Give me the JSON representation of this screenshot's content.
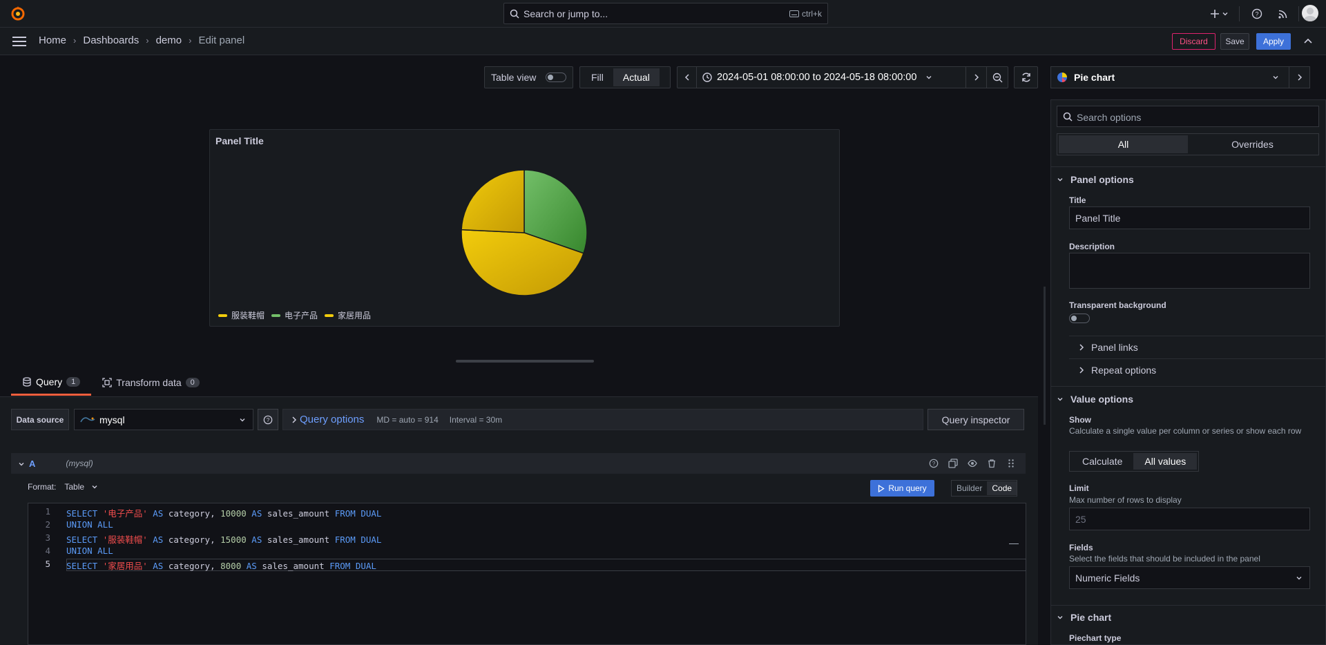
{
  "topbar": {
    "search_placeholder": "Search or jump to...",
    "search_shortcut": "ctrl+k"
  },
  "breadcrumb": {
    "items": [
      "Home",
      "Dashboards",
      "demo"
    ],
    "current": "Edit panel"
  },
  "actions": {
    "discard": "Discard",
    "save": "Save",
    "apply": "Apply"
  },
  "viz_toolbar": {
    "table_view": "Table view",
    "fill": "Fill",
    "actual": "Actual",
    "time_range": "2024-05-01 08:00:00 to 2024-05-18 08:00:00"
  },
  "panel": {
    "title": "Panel Title",
    "legend": [
      {
        "label": "服装鞋帽",
        "color": "#f2cc0c"
      },
      {
        "label": "电子产品",
        "color": "#73bf69"
      },
      {
        "label": "家居用品",
        "color": "#f2cc0c"
      }
    ]
  },
  "chart_data": {
    "type": "pie",
    "categories": [
      "电子产品",
      "服装鞋帽",
      "家居用品"
    ],
    "values": [
      10000,
      15000,
      8000
    ],
    "colors": [
      "#73bf69",
      "#f2cc0c",
      "#f2cc0c"
    ],
    "legend_position": "bottom-left"
  },
  "query_tabs": [
    {
      "label": "Query",
      "count": "1"
    },
    {
      "label": "Transform data",
      "count": "0"
    }
  ],
  "query": {
    "data_source_label": "Data source",
    "data_source": "mysql",
    "options_label": "Query options",
    "md_info": "MD = auto = 914",
    "interval_info": "Interval = 30m",
    "inspector": "Query inspector",
    "ref_id": "A",
    "ref_ds": "(mysql)",
    "format_label": "Format:",
    "format_value": "Table",
    "run": "Run query",
    "builder": "Builder",
    "code": "Code",
    "lines": [
      {
        "n": "1",
        "tokens": [
          [
            "kw",
            "SELECT "
          ],
          [
            "str",
            "'电子产品'"
          ],
          [
            "kw",
            " AS "
          ],
          [
            "t",
            "category, "
          ],
          [
            "num",
            "10000"
          ],
          [
            "kw",
            " AS "
          ],
          [
            "t",
            "sales_amount "
          ],
          [
            "kw",
            "FROM DUAL"
          ]
        ]
      },
      {
        "n": "2",
        "tokens": [
          [
            "kw",
            "UNION ALL"
          ]
        ]
      },
      {
        "n": "3",
        "tokens": [
          [
            "kw",
            "SELECT "
          ],
          [
            "str",
            "'服装鞋帽'"
          ],
          [
            "kw",
            " AS "
          ],
          [
            "t",
            "category, "
          ],
          [
            "num",
            "15000"
          ],
          [
            "kw",
            " AS "
          ],
          [
            "t",
            "sales_amount "
          ],
          [
            "kw",
            "FROM DUAL"
          ]
        ]
      },
      {
        "n": "4",
        "tokens": [
          [
            "kw",
            "UNION ALL"
          ]
        ]
      },
      {
        "n": "5",
        "tokens": [
          [
            "kw",
            "SELECT "
          ],
          [
            "str",
            "'家居用品'"
          ],
          [
            "kw",
            " AS "
          ],
          [
            "t",
            "category, "
          ],
          [
            "num",
            "8000"
          ],
          [
            "kw",
            " AS "
          ],
          [
            "t",
            "sales_amount "
          ],
          [
            "kw",
            "FROM DUAL"
          ]
        ]
      }
    ]
  },
  "options": {
    "viz_type": "Pie chart",
    "search_placeholder": "Search options",
    "tab_all": "All",
    "tab_overrides": "Overrides",
    "panel_options": "Panel options",
    "title_label": "Title",
    "title_value": "Panel Title",
    "description_label": "Description",
    "transparent_label": "Transparent background",
    "panel_links": "Panel links",
    "repeat_options": "Repeat options",
    "value_options": "Value options",
    "show_label": "Show",
    "show_hint": "Calculate a single value per column or series or show each row",
    "calculate": "Calculate",
    "all_values": "All values",
    "limit_label": "Limit",
    "limit_hint": "Max number of rows to display",
    "limit_placeholder": "25",
    "fields_label": "Fields",
    "fields_hint": "Select the fields that should be included in the panel",
    "fields_value": "Numeric Fields",
    "pie_section": "Pie chart",
    "piechart_type": "Piechart type"
  }
}
